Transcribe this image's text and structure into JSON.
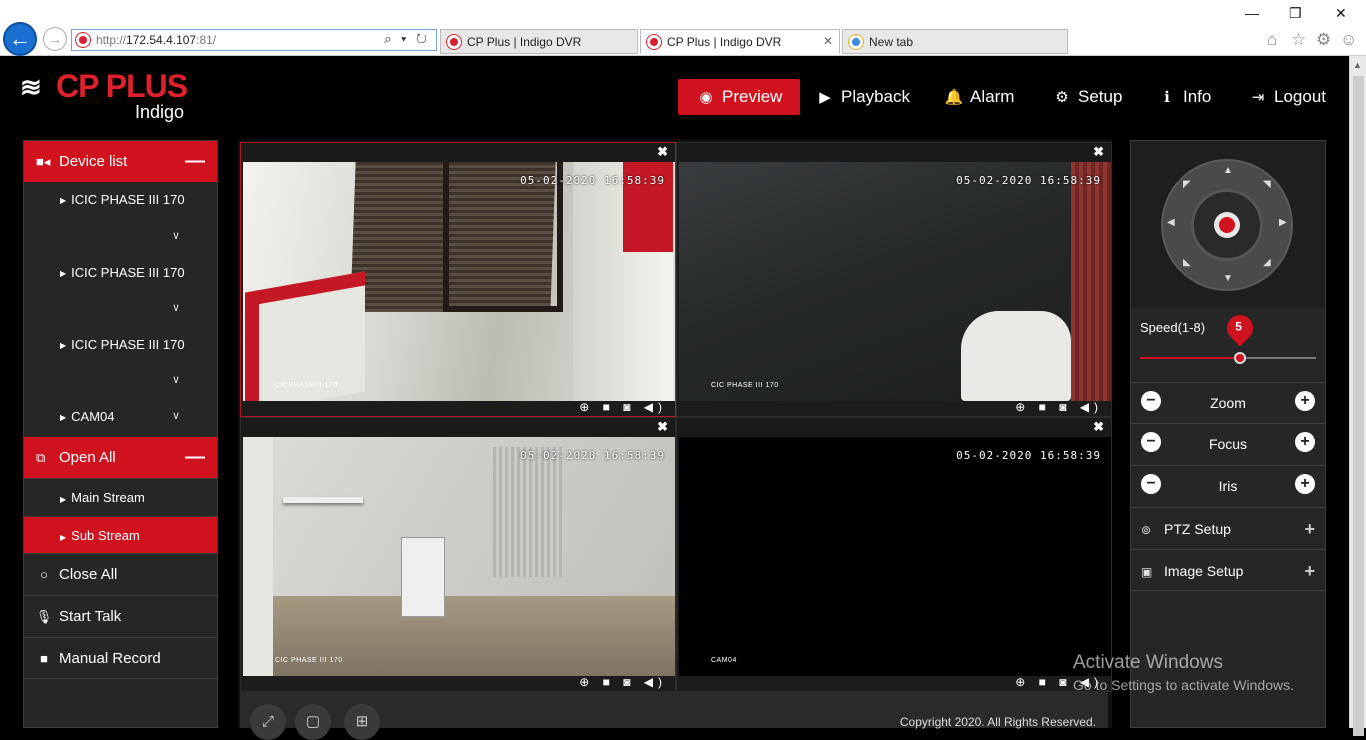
{
  "browser": {
    "url_prefix": "http://",
    "url_host": "172.54.4.107",
    "url_suffix": ":81/",
    "address_tools": "⌕ ▾ ↻",
    "tabs": [
      {
        "title": "CP Plus | Indigo DVR"
      },
      {
        "title": "CP Plus | Indigo DVR"
      },
      {
        "title": "New tab"
      }
    ],
    "window_controls": [
      "—",
      "❐",
      "✕"
    ],
    "toolbar_icons": [
      "⌂",
      "☆",
      "⚙",
      "☺"
    ]
  },
  "app": {
    "brand": "CP PLUS",
    "brand_sub": "Indigo",
    "logo_mark": "≋"
  },
  "topnav": [
    {
      "label": "Preview",
      "icon": "eye-icon",
      "glyph": "◉"
    },
    {
      "label": "Playback",
      "icon": "play-icon",
      "glyph": "▶"
    },
    {
      "label": "Alarm",
      "icon": "bell-icon",
      "glyph": "🔔"
    },
    {
      "label": "Setup",
      "icon": "gear-icon",
      "glyph": "⚙"
    },
    {
      "label": "Info",
      "icon": "info-icon",
      "glyph": "ℹ"
    },
    {
      "label": "Logout",
      "icon": "logout-icon",
      "glyph": "⇥"
    }
  ],
  "sidebar": {
    "device_list_label": "Device list",
    "devices": [
      {
        "label": "ICIC PHASE III 170"
      },
      {
        "label": "ICIC PHASE III 170"
      },
      {
        "label": "ICIC PHASE III 170"
      },
      {
        "label": "CAM04"
      }
    ],
    "open_all_label": "Open All",
    "streams": [
      {
        "label": "Main Stream"
      },
      {
        "label": "Sub Stream"
      }
    ],
    "actions": [
      {
        "label": "Close All",
        "icon": "circle-icon"
      },
      {
        "label": "Start Talk",
        "icon": "microphone-icon"
      },
      {
        "label": "Manual Record",
        "icon": "video-camera-icon"
      }
    ]
  },
  "video": {
    "cells": [
      {
        "timestamp": "05-02-2020 16:58:39",
        "camera": "CICPHASEIII 170"
      },
      {
        "timestamp": "05-02-2020 16:58:39",
        "camera": "CIC PHASE III 170"
      },
      {
        "timestamp": "05-02-2020 16:58:39",
        "camera": "CIC PHASE III 170"
      },
      {
        "timestamp": "05-02-2020 16:58:39",
        "camera": "CAM04"
      }
    ],
    "close_glyph": "✖",
    "cell_controls": "⊕ ■ ◙ ◀)",
    "copyright": "Copyright 2020. All Rights Reserved."
  },
  "ptz": {
    "speed_label": "Speed(1-8)",
    "speed_value": "5",
    "speed_fraction": 0.57,
    "zoom_label": "Zoom",
    "focus_label": "Focus",
    "iris_label": "Iris",
    "ptz_setup_label": "PTZ Setup",
    "image_setup_label": "Image Setup"
  },
  "watermark": {
    "line1": "Activate Windows",
    "line2": "Go to Settings to activate Windows."
  },
  "colors": {
    "accent": "#d0111e",
    "panel": "#262626",
    "background": "#000000"
  }
}
